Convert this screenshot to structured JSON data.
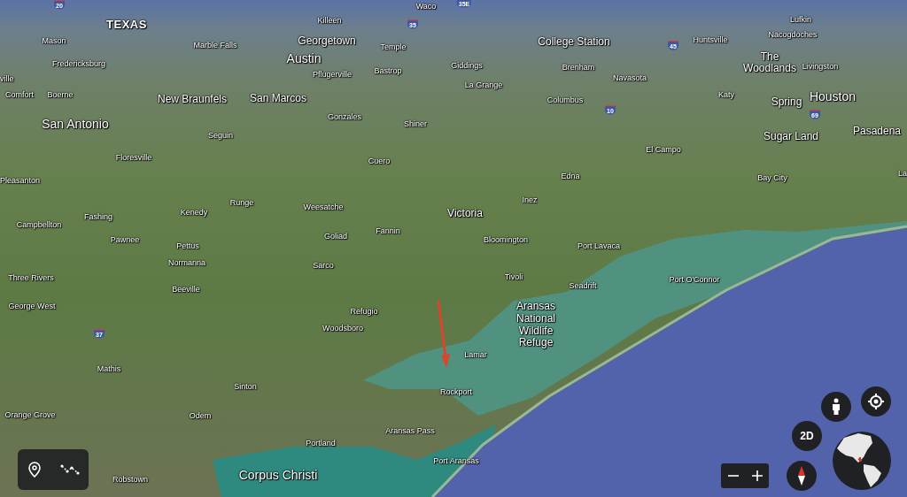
{
  "map": {
    "labels": [
      {
        "text": "Waco",
        "kind": "town"
      },
      {
        "text": "TEXAS",
        "kind": "state"
      },
      {
        "text": "Killeen",
        "kind": "town"
      },
      {
        "text": "Lufkin",
        "kind": "town"
      },
      {
        "text": "Mason",
        "kind": "town"
      },
      {
        "text": "Marble Falls",
        "kind": "town"
      },
      {
        "text": "Georgetown",
        "kind": "city"
      },
      {
        "text": "Temple",
        "kind": "town"
      },
      {
        "text": "College Station",
        "kind": "city"
      },
      {
        "text": "Huntsville",
        "kind": "town"
      },
      {
        "text": "Nacogdoches",
        "kind": "town"
      },
      {
        "text": "Fredericksburg",
        "kind": "town"
      },
      {
        "text": "ville",
        "kind": "town"
      },
      {
        "text": "Austin",
        "kind": "major"
      },
      {
        "text": "Pflugerville",
        "kind": "town"
      },
      {
        "text": "Bastrop",
        "kind": "town"
      },
      {
        "text": "Giddings",
        "kind": "town"
      },
      {
        "text": "Brenham",
        "kind": "town"
      },
      {
        "text": "The Woodlands",
        "kind": "city"
      },
      {
        "text": "Livingston",
        "kind": "town"
      },
      {
        "text": "La Grange",
        "kind": "town"
      },
      {
        "text": "Navasota",
        "kind": "town"
      },
      {
        "text": "Comfort",
        "kind": "town"
      },
      {
        "text": "Boerne",
        "kind": "town"
      },
      {
        "text": "New Braunfels",
        "kind": "city"
      },
      {
        "text": "San Marcos",
        "kind": "city"
      },
      {
        "text": "Columbus",
        "kind": "town"
      },
      {
        "text": "Katy",
        "kind": "town"
      },
      {
        "text": "Spring",
        "kind": "city"
      },
      {
        "text": "Houston",
        "kind": "major"
      },
      {
        "text": "San Antonio",
        "kind": "major"
      },
      {
        "text": "Seguin",
        "kind": "town"
      },
      {
        "text": "Gonzales",
        "kind": "town"
      },
      {
        "text": "Shiner",
        "kind": "town"
      },
      {
        "text": "Sugar Land",
        "kind": "city"
      },
      {
        "text": "Pasadena",
        "kind": "city"
      },
      {
        "text": "Floresville",
        "kind": "town"
      },
      {
        "text": "Cuero",
        "kind": "town"
      },
      {
        "text": "El Campo",
        "kind": "town"
      },
      {
        "text": "Pleasanton",
        "kind": "town"
      },
      {
        "text": "Edna",
        "kind": "town"
      },
      {
        "text": "Bay City",
        "kind": "town"
      },
      {
        "text": "La",
        "kind": "town"
      },
      {
        "text": "Fashing",
        "kind": "town"
      },
      {
        "text": "Kenedy",
        "kind": "town"
      },
      {
        "text": "Runge",
        "kind": "town"
      },
      {
        "text": "Weesatche",
        "kind": "town"
      },
      {
        "text": "Victoria",
        "kind": "city"
      },
      {
        "text": "Inez",
        "kind": "town"
      },
      {
        "text": "Campbellton",
        "kind": "town"
      },
      {
        "text": "Pawnee",
        "kind": "town"
      },
      {
        "text": "Pettus",
        "kind": "town"
      },
      {
        "text": "Goliad",
        "kind": "town"
      },
      {
        "text": "Fannin",
        "kind": "town"
      },
      {
        "text": "Bloomington",
        "kind": "town"
      },
      {
        "text": "Port Lavaca",
        "kind": "town"
      },
      {
        "text": "Normanna",
        "kind": "town"
      },
      {
        "text": "Sarco",
        "kind": "town"
      },
      {
        "text": "Three Rivers",
        "kind": "town"
      },
      {
        "text": "Beeville",
        "kind": "town"
      },
      {
        "text": "Tivoli",
        "kind": "town"
      },
      {
        "text": "Seadrift",
        "kind": "town"
      },
      {
        "text": "Port O'Connor",
        "kind": "town"
      },
      {
        "text": "George West",
        "kind": "town"
      },
      {
        "text": "Refugio",
        "kind": "town"
      },
      {
        "text": "Woodsboro",
        "kind": "town"
      },
      {
        "text": "Aransas National Wildlife Refuge",
        "kind": "area"
      },
      {
        "text": "Lamar",
        "kind": "town"
      },
      {
        "text": "Mathis",
        "kind": "town"
      },
      {
        "text": "Sinton",
        "kind": "town"
      },
      {
        "text": "Rockport",
        "kind": "town"
      },
      {
        "text": "Orange Grove",
        "kind": "town"
      },
      {
        "text": "Odem",
        "kind": "town"
      },
      {
        "text": "Aransas Pass",
        "kind": "town"
      },
      {
        "text": "Portland",
        "kind": "town"
      },
      {
        "text": "Port Aransas",
        "kind": "town"
      },
      {
        "text": "Robstown",
        "kind": "town"
      },
      {
        "text": "Corpus Christi",
        "kind": "major"
      }
    ],
    "highway_shields": [
      {
        "number": "20"
      },
      {
        "number": "35E"
      },
      {
        "number": "35"
      },
      {
        "number": "45"
      },
      {
        "number": "10"
      },
      {
        "number": "69"
      },
      {
        "number": "37"
      }
    ]
  },
  "view_toggle": {
    "label": "2D"
  }
}
